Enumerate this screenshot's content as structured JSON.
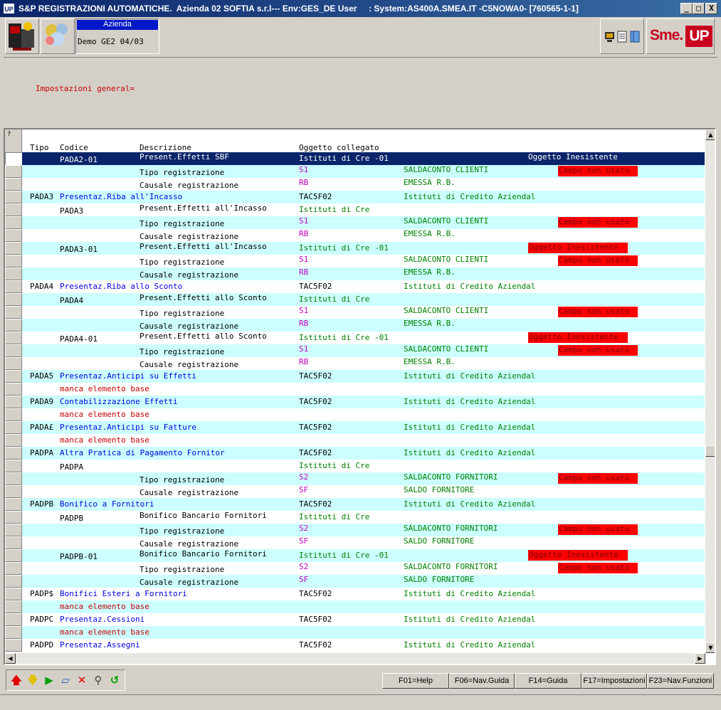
{
  "window": {
    "app_icon": "UP",
    "title": "S&P REGISTRAZIONI AUTOMATICHE.  Azienda 02 SOFTIA s.r.l--- Env:GES_DE User     : System:AS400A.SMEA.IT -C5NOWA0- [760565-1-1]",
    "min_label": "_",
    "max_label": "□",
    "close_label": "X"
  },
  "toolbar": {
    "azienda_label": "Azienda",
    "azienda_value": "Demo GE2 04/03",
    "logo_text_1": "Sme.",
    "logo_text_2": "UP",
    "icon_names": [
      "computer-icon",
      "document-icon",
      "book-icon"
    ]
  },
  "header": {
    "title": "Impostazioni general="
  },
  "grid": {
    "corner_label": "?",
    "columns": {
      "tipo": "Tipo",
      "codice": "Codice",
      "descrizione": "Descrizione",
      "oggetto": "Oggetto collegato"
    },
    "rows": [
      {
        "sel": true,
        "tipo": "",
        "codice": "PADA2-01",
        "desc": "Present.Effetti SBF",
        "desc_c": "wht",
        "ogg": "Istituti di Cre -01",
        "ogg_c": "wht",
        "extra": "",
        "extra_c": "",
        "flag": "Oggetto Inesistente",
        "flag_type": "text"
      },
      {
        "tipo": "",
        "codice": "",
        "desc": "Tipo registrazione",
        "desc_c": "blk",
        "ogg": "S1",
        "ogg_c": "mag",
        "extra": "SALDACONTO CLIENTI",
        "extra_c": "grn",
        "flag": "Campo non usato",
        "flag_type": "badge"
      },
      {
        "tipo": "",
        "codice": "",
        "desc": "Causale registrazione",
        "desc_c": "blk",
        "ogg": "RB",
        "ogg_c": "mag",
        "extra": "EMESSA R.B.",
        "extra_c": "grn",
        "flag": "",
        "flag_type": ""
      },
      {
        "tipo": "PADA3",
        "codice": "Presentaz.Riba all'Incasso",
        "codice_c": "blu",
        "desc": "",
        "desc_c": "",
        "ogg": "TAC5F02",
        "ogg_c": "blk",
        "extra": "Istituti di Credito Aziendal",
        "extra_c": "grn",
        "flag": "",
        "flag_type": ""
      },
      {
        "tipo": "",
        "codice": "PADA3",
        "desc": "Present.Effetti all'Incasso",
        "desc_c": "blk",
        "ogg": "Istituti di Cre",
        "ogg_c": "grn",
        "extra": "",
        "extra_c": "",
        "flag": "",
        "flag_type": ""
      },
      {
        "tipo": "",
        "codice": "",
        "desc": "Tipo registrazione",
        "desc_c": "blk",
        "ogg": "S1",
        "ogg_c": "mag",
        "extra": "SALDACONTO CLIENTI",
        "extra_c": "grn",
        "flag": "Campo non usato",
        "flag_type": "badge"
      },
      {
        "tipo": "",
        "codice": "",
        "desc": "Causale registrazione",
        "desc_c": "blk",
        "ogg": "RB",
        "ogg_c": "mag",
        "extra": "EMESSA R.B.",
        "extra_c": "grn",
        "flag": "",
        "flag_type": ""
      },
      {
        "tipo": "",
        "codice": "PADA3-01",
        "desc": "Present.Effetti all'Incasso",
        "desc_c": "blk",
        "ogg": "Istituti di Cre -01",
        "ogg_c": "grn",
        "extra": "",
        "extra_c": "",
        "flag": "Oggetto Inesistente",
        "flag_type": "badge2"
      },
      {
        "tipo": "",
        "codice": "",
        "desc": "Tipo registrazione",
        "desc_c": "blk",
        "ogg": "S1",
        "ogg_c": "mag",
        "extra": "SALDACONTO CLIENTI",
        "extra_c": "grn",
        "flag": "Campo non usato",
        "flag_type": "badge"
      },
      {
        "tipo": "",
        "codice": "",
        "desc": "Causale registrazione",
        "desc_c": "blk",
        "ogg": "RB",
        "ogg_c": "mag",
        "extra": "EMESSA R.B.",
        "extra_c": "grn",
        "flag": "",
        "flag_type": ""
      },
      {
        "tipo": "PADA4",
        "codice": "Presentaz.Riba allo Sconto",
        "codice_c": "blu",
        "desc": "",
        "desc_c": "",
        "ogg": "TAC5F02",
        "ogg_c": "blk",
        "extra": "Istituti di Credito Aziendal",
        "extra_c": "grn",
        "flag": "",
        "flag_type": ""
      },
      {
        "tipo": "",
        "codice": "PADA4",
        "desc": "Present.Effetti allo Sconto",
        "desc_c": "blk",
        "ogg": "Istituti di Cre",
        "ogg_c": "grn",
        "extra": "",
        "extra_c": "",
        "flag": "",
        "flag_type": ""
      },
      {
        "tipo": "",
        "codice": "",
        "desc": "Tipo registrazione",
        "desc_c": "blk",
        "ogg": "S1",
        "ogg_c": "mag",
        "extra": "SALDACONTO CLIENTI",
        "extra_c": "grn",
        "flag": "Campo non usato",
        "flag_type": "badge"
      },
      {
        "tipo": "",
        "codice": "",
        "desc": "Causale registrazione",
        "desc_c": "blk",
        "ogg": "RB",
        "ogg_c": "mag",
        "extra": "EMESSA R.B.",
        "extra_c": "grn",
        "flag": "",
        "flag_type": ""
      },
      {
        "tipo": "",
        "codice": "PADA4-01",
        "desc": "Present.Effetti allo Sconto",
        "desc_c": "blk",
        "ogg": "Istituti di Cre -01",
        "ogg_c": "grn",
        "extra": "",
        "extra_c": "",
        "flag": "Oggetto Inesistente",
        "flag_type": "badge2"
      },
      {
        "tipo": "",
        "codice": "",
        "desc": "Tipo registrazione",
        "desc_c": "blk",
        "ogg": "S1",
        "ogg_c": "mag",
        "extra": "SALDACONTO CLIENTI",
        "extra_c": "grn",
        "flag": "Campo non usato",
        "flag_type": "badge"
      },
      {
        "tipo": "",
        "codice": "",
        "desc": "Causale registrazione",
        "desc_c": "blk",
        "ogg": "RB",
        "ogg_c": "mag",
        "extra": "EMESSA R.B.",
        "extra_c": "grn",
        "flag": "",
        "flag_type": ""
      },
      {
        "tipo": "PADA5",
        "codice": "Presentaz.Anticipi su Effetti",
        "codice_c": "blu",
        "desc": "",
        "desc_c": "",
        "ogg": "TAC5F02",
        "ogg_c": "blk",
        "extra": "Istituti di Credito Aziendal",
        "extra_c": "grn",
        "flag": "",
        "flag_type": ""
      },
      {
        "tipo": "",
        "codice": "manca elemento base",
        "codice_c": "red",
        "desc": "",
        "desc_c": "",
        "ogg": "",
        "ogg_c": "",
        "extra": "",
        "extra_c": "",
        "flag": "",
        "flag_type": ""
      },
      {
        "tipo": "PADA9",
        "codice": "Contabilizzazione Effetti",
        "codice_c": "blu",
        "desc": "",
        "desc_c": "",
        "ogg": "TAC5F02",
        "ogg_c": "blk",
        "extra": "Istituti di Credito Aziendal",
        "extra_c": "grn",
        "flag": "",
        "flag_type": ""
      },
      {
        "tipo": "",
        "codice": "manca elemento base",
        "codice_c": "red",
        "desc": "",
        "desc_c": "",
        "ogg": "",
        "ogg_c": "",
        "extra": "",
        "extra_c": "",
        "flag": "",
        "flag_type": ""
      },
      {
        "tipo": "PADA£",
        "codice": "Presentaz.Anticipi su Fatture",
        "codice_c": "blu",
        "desc": "",
        "desc_c": "",
        "ogg": "TAC5F02",
        "ogg_c": "blk",
        "extra": "Istituti di Credito Aziendal",
        "extra_c": "grn",
        "flag": "",
        "flag_type": ""
      },
      {
        "tipo": "",
        "codice": "manca elemento base",
        "codice_c": "red",
        "desc": "",
        "desc_c": "",
        "ogg": "",
        "ogg_c": "",
        "extra": "",
        "extra_c": "",
        "flag": "",
        "flag_type": ""
      },
      {
        "tipo": "PADPA",
        "codice": "Altra Pratica di Pagamento Fornitor",
        "codice_c": "blu",
        "desc": "",
        "desc_c": "",
        "ogg": "TAC5F02",
        "ogg_c": "blk",
        "extra": "Istituti di Credito Aziendal",
        "extra_c": "grn",
        "flag": "",
        "flag_type": ""
      },
      {
        "tipo": "",
        "codice": "PADPA",
        "desc": "",
        "desc_c": "",
        "ogg": "Istituti di Cre",
        "ogg_c": "grn",
        "extra": "",
        "extra_c": "",
        "flag": "",
        "flag_type": ""
      },
      {
        "tipo": "",
        "codice": "",
        "desc": "Tipo registrazione",
        "desc_c": "blk",
        "ogg": "S2",
        "ogg_c": "mag",
        "extra": "SALDACONTO FORNITORI",
        "extra_c": "grn",
        "flag": "Campo non usato",
        "flag_type": "badge"
      },
      {
        "tipo": "",
        "codice": "",
        "desc": "Causale registrazione",
        "desc_c": "blk",
        "ogg": "SF",
        "ogg_c": "mag",
        "extra": "SALDO FORNITORE",
        "extra_c": "grn",
        "flag": "",
        "flag_type": ""
      },
      {
        "tipo": "PADPB",
        "codice": "Bonifico a Fornitori",
        "codice_c": "blu",
        "desc": "",
        "desc_c": "",
        "ogg": "TAC5F02",
        "ogg_c": "blk",
        "extra": "Istituti di Credito Aziendal",
        "extra_c": "grn",
        "flag": "",
        "flag_type": ""
      },
      {
        "tipo": "",
        "codice": "PADPB",
        "desc": "Bonifico Bancario Fornitori",
        "desc_c": "blk",
        "ogg": "Istituti di Cre",
        "ogg_c": "grn",
        "extra": "",
        "extra_c": "",
        "flag": "",
        "flag_type": ""
      },
      {
        "tipo": "",
        "codice": "",
        "desc": "Tipo registrazione",
        "desc_c": "blk",
        "ogg": "S2",
        "ogg_c": "mag",
        "extra": "SALDACONTO FORNITORI",
        "extra_c": "grn",
        "flag": "Campo non usato",
        "flag_type": "badge"
      },
      {
        "tipo": "",
        "codice": "",
        "desc": "Causale registrazione",
        "desc_c": "blk",
        "ogg": "SF",
        "ogg_c": "mag",
        "extra": "SALDO FORNITORE",
        "extra_c": "grn",
        "flag": "",
        "flag_type": ""
      },
      {
        "tipo": "",
        "codice": "PADPB-01",
        "desc": "Bonifico Bancario Fornitori",
        "desc_c": "blk",
        "ogg": "Istituti di Cre -01",
        "ogg_c": "grn",
        "extra": "",
        "extra_c": "",
        "flag": "Oggetto Inesistente",
        "flag_type": "badge2"
      },
      {
        "tipo": "",
        "codice": "",
        "desc": "Tipo registrazione",
        "desc_c": "blk",
        "ogg": "S2",
        "ogg_c": "mag",
        "extra": "SALDACONTO FORNITORI",
        "extra_c": "grn",
        "flag": "Campo non usato",
        "flag_type": "badge"
      },
      {
        "tipo": "",
        "codice": "",
        "desc": "Causale registrazione",
        "desc_c": "blk",
        "ogg": "SF",
        "ogg_c": "mag",
        "extra": "SALDO FORNITORE",
        "extra_c": "grn",
        "flag": "",
        "flag_type": ""
      },
      {
        "tipo": "PADP$",
        "codice": "Bonifici Esteri a Fornitori",
        "codice_c": "blu",
        "desc": "",
        "desc_c": "",
        "ogg": "TAC5F02",
        "ogg_c": "blk",
        "extra": "Istituti di Credito Aziendal",
        "extra_c": "grn",
        "flag": "",
        "flag_type": ""
      },
      {
        "tipo": "",
        "codice": "manca elemento base",
        "codice_c": "red",
        "desc": "",
        "desc_c": "",
        "ogg": "",
        "ogg_c": "",
        "extra": "",
        "extra_c": "",
        "flag": "",
        "flag_type": ""
      },
      {
        "tipo": "PADPC",
        "codice": "Presentaz.Cessioni",
        "codice_c": "blu",
        "desc": "",
        "desc_c": "",
        "ogg": "TAC5F02",
        "ogg_c": "blk",
        "extra": "Istituti di Credito Aziendal",
        "extra_c": "grn",
        "flag": "",
        "flag_type": ""
      },
      {
        "tipo": "",
        "codice": "manca elemento base",
        "codice_c": "red",
        "desc": "",
        "desc_c": "",
        "ogg": "",
        "ogg_c": "",
        "extra": "",
        "extra_c": "",
        "flag": "",
        "flag_type": ""
      },
      {
        "tipo": "PADPD",
        "codice": "Presentaz.Assegni",
        "codice_c": "blu",
        "desc": "",
        "desc_c": "",
        "ogg": "TAC5F02",
        "ogg_c": "blk",
        "extra": "Istituti di Credito Aziendal",
        "extra_c": "grn",
        "flag": "",
        "flag_type": ""
      }
    ]
  },
  "bottom": {
    "tool_icons": [
      {
        "name": "arrow-up-icon",
        "glyph": "🡅",
        "color": "#e00000"
      },
      {
        "name": "arrow-down-icon",
        "glyph": "🡇",
        "color": "#e0c000"
      },
      {
        "name": "play-icon",
        "glyph": "▶",
        "color": "#00a000"
      },
      {
        "name": "eraser-icon",
        "glyph": "▱",
        "color": "#2060c0"
      },
      {
        "name": "delete-icon",
        "glyph": "✕",
        "color": "#e00000"
      },
      {
        "name": "search-icon",
        "glyph": "⚲",
        "color": "#404040"
      },
      {
        "name": "refresh-icon",
        "glyph": "↺",
        "color": "#00a000"
      }
    ],
    "fkeys": [
      "F01=Help",
      "F06=Nav.Guida",
      "F14=Guida",
      "F17=Impostazioni",
      "F23=Nav.Funzioni"
    ]
  },
  "colors": {
    "row_cyan": "#ccffff",
    "selected": "#0a246a",
    "flag_red": "#ff0000"
  }
}
